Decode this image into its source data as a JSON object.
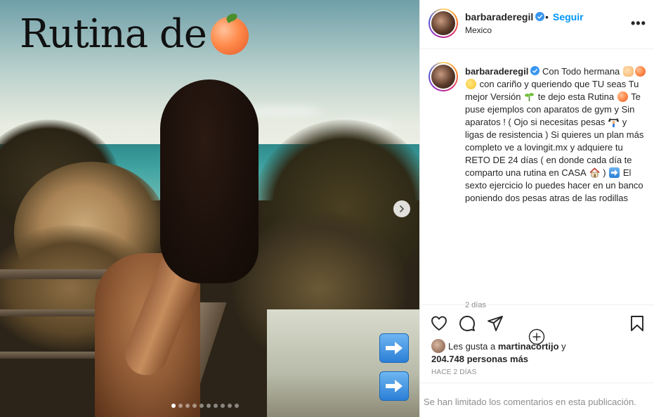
{
  "media": {
    "overlay_title": "Rutina de",
    "overlay_emoji": "peach-icon",
    "carousel_count": 10,
    "carousel_active_index": 0
  },
  "post_header": {
    "username": "barbaraderegil",
    "separator": "•",
    "follow_label": "Seguir",
    "location": "Mexico",
    "more_icon": "more-horizontal-icon"
  },
  "caption": {
    "username": "barbaraderegil",
    "segments": [
      "Con Todo hermana",
      "con cariño y queriendo que TU seas Tu mejor Versión",
      "te dejo esta Rutina",
      "Te puse ejemplos con aparatos de gym y Sin aparatos ! ( Ojo si necesitas pesas",
      "y ligas de resistencia )",
      "Si quieres un plan más completo ve a lovingit.mx y adquiere tu RETO DE 24 días ( en donde cada día te comparto una rutina en CASA",
      ")",
      "El sexto ejercicio lo puedes hacer en un banco poniendo dos pesas atras de las rodillas"
    ],
    "time_ago": "2 días"
  },
  "actions": {
    "like_icon": "heart-icon",
    "comment_icon": "comment-icon",
    "share_icon": "share-icon",
    "save_icon": "bookmark-icon"
  },
  "likes": {
    "prefix": "Les gusta a",
    "first_user": "martinacortijo",
    "conjunction": "y",
    "count_text": "204.748 personas más"
  },
  "posted_time": "HACE 2 DÍAS",
  "comments_notice": "Se han limitado los comentarios en esta publicación."
}
